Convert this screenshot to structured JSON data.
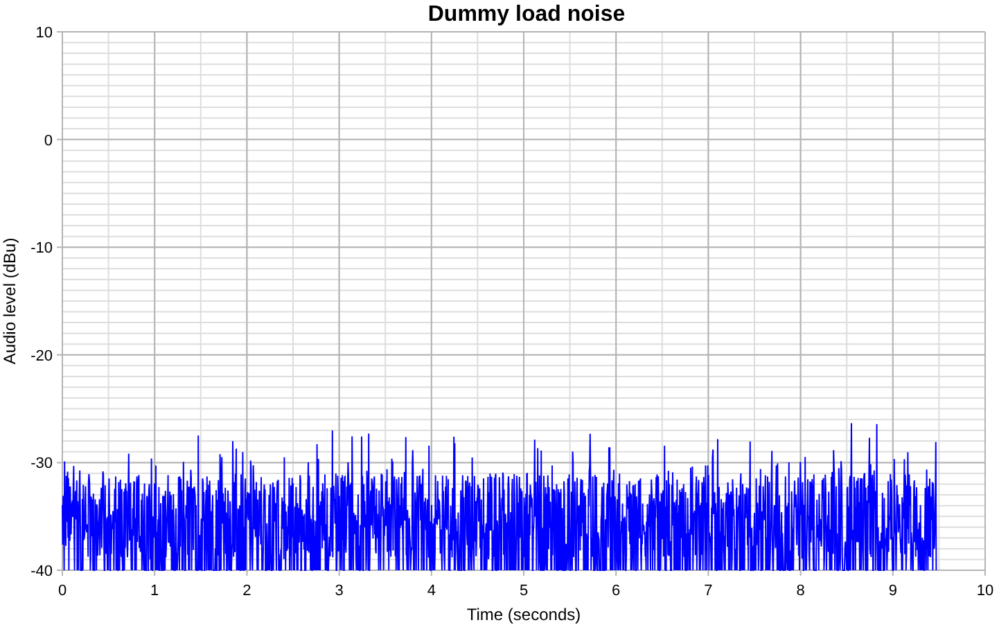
{
  "chart_data": {
    "type": "line",
    "grid": true,
    "title": "Dummy load noise",
    "xlabel": "Time (seconds)",
    "ylabel": "Audio level (dBu)",
    "xlim": [
      0,
      10
    ],
    "ylim": [
      -40,
      10
    ],
    "xticks": [
      0,
      1,
      2,
      3,
      4,
      5,
      6,
      7,
      8,
      9,
      10
    ],
    "yticks": [
      10,
      0,
      -10,
      -20,
      -30,
      -40
    ]
  }
}
